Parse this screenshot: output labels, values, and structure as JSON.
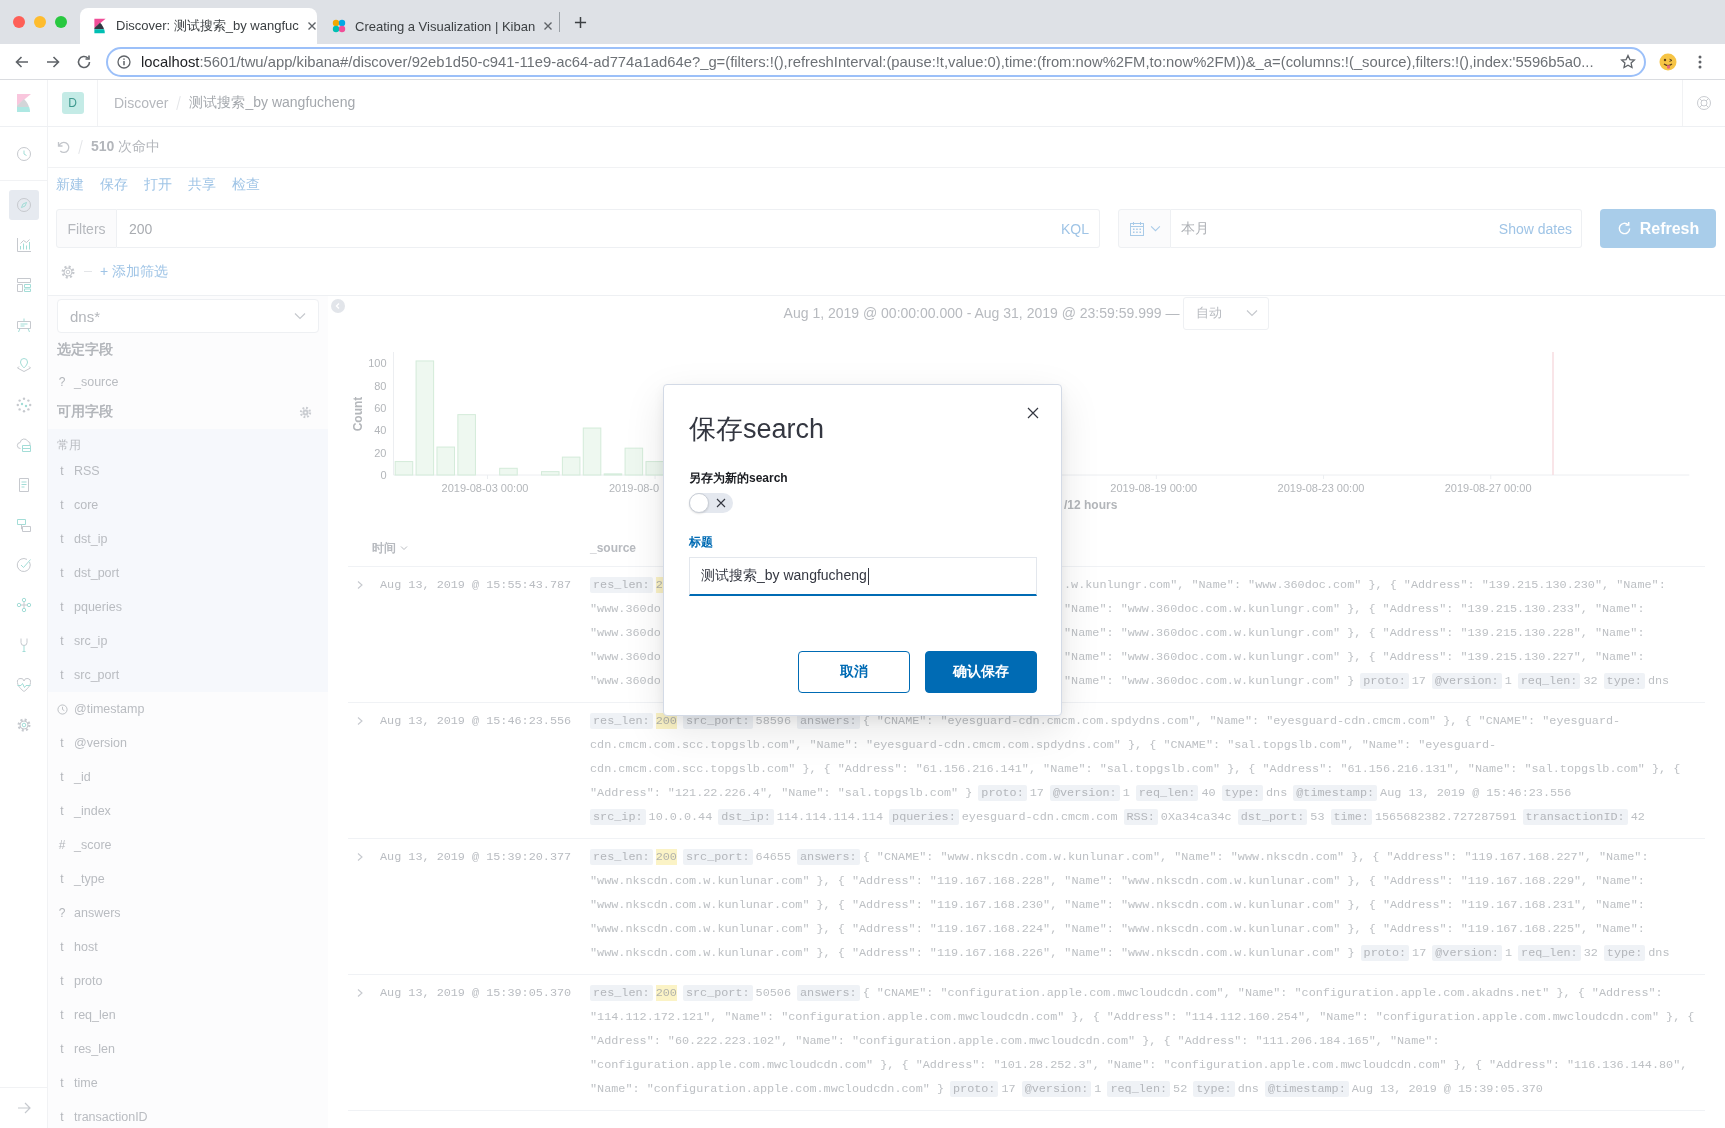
{
  "browser": {
    "tabs": [
      {
        "title": "Discover: 测试搜索_by wangfuc",
        "selected": true
      },
      {
        "title": "Creating a Visualization | Kiban",
        "selected": false
      }
    ],
    "address": {
      "host": "localhost",
      "path": ":5601/twu/app/kibana#/discover/92eb1d50-c941-11e9-ac64-ad774a1ad64e?_g=(filters:!(),refreshInterval:(pause:!t,value:0),time:(from:now%2FM,to:now%2FM))&_a=(columns:!(_source),filters:!(),index:'5596b5a0..."
    }
  },
  "header": {
    "avatar": "D",
    "breadcrumbs": [
      "Discover",
      "测试搜索_by wangfucheng"
    ]
  },
  "nav": {
    "items": [
      {
        "selected": false
      },
      {
        "selected": true
      },
      {
        "selected": false
      },
      {
        "selected": false
      },
      {
        "selected": false
      },
      {
        "selected": false
      },
      {
        "selected": false
      },
      {
        "selected": false
      },
      {
        "selected": false
      },
      {
        "selected": false
      },
      {
        "selected": false
      },
      {
        "selected": false
      },
      {
        "selected": false
      },
      {
        "selected": false
      },
      {
        "selected": false
      }
    ]
  },
  "hits": "**510** 次命中",
  "menu": [
    "新建",
    "保存",
    "打开",
    "共享",
    "检查"
  ],
  "query": {
    "prefix": "Filters",
    "value": "200",
    "language": "KQL"
  },
  "date_picker": {
    "value": "本月",
    "show_dates": "Show dates",
    "refresh": "Refresh"
  },
  "filter_bar": {
    "add": "+ 添加筛选"
  },
  "sidebar": {
    "index_pattern": "dns*",
    "selected": {
      "title": "选定字段",
      "fields": [
        {
          "kind": "typed",
          "type": "?",
          "name": "_source"
        }
      ]
    },
    "available": {
      "title": "可用字段",
      "popular": {
        "title": "常用",
        "fields": [
          {
            "kind": "typed",
            "type": "t",
            "name": "RSS"
          },
          {
            "kind": "typed",
            "type": "t",
            "name": "core"
          },
          {
            "kind": "typed",
            "type": "t",
            "name": "dst_ip"
          },
          {
            "kind": "typed",
            "type": "t",
            "name": "dst_port"
          },
          {
            "kind": "typed",
            "type": "t",
            "name": "pqueries"
          },
          {
            "kind": "typed",
            "type": "t",
            "name": "src_ip"
          },
          {
            "kind": "typed",
            "type": "t",
            "name": "src_port"
          }
        ]
      },
      "fields": [
        {
          "kind": "date",
          "name": "@timestamp"
        },
        {
          "kind": "typed",
          "type": "t",
          "name": "@version"
        },
        {
          "kind": "typed",
          "type": "t",
          "name": "_id"
        },
        {
          "kind": "typed",
          "type": "t",
          "name": "_index"
        },
        {
          "kind": "typed",
          "type": "#",
          "name": "_score"
        },
        {
          "kind": "typed",
          "type": "t",
          "name": "_type"
        },
        {
          "kind": "typed",
          "type": "?",
          "name": "answers"
        },
        {
          "kind": "typed",
          "type": "t",
          "name": "host"
        },
        {
          "kind": "typed",
          "type": "t",
          "name": "proto"
        },
        {
          "kind": "typed",
          "type": "t",
          "name": "req_len"
        },
        {
          "kind": "typed",
          "type": "t",
          "name": "res_len"
        },
        {
          "kind": "typed",
          "type": "t",
          "name": "time"
        },
        {
          "kind": "typed",
          "type": "t",
          "name": "transactionID"
        }
      ]
    }
  },
  "main": {
    "time_range": "Aug 1, 2019 @ 00:00:00.000 - Aug 31, 2019 @ 23:59:59.999 —",
    "interval": "自动",
    "chart_data": {
      "type": "bar",
      "ylabel": "Count",
      "xlabel": "/12 hours",
      "categories": [
        null,
        null,
        null,
        null,
        "2019-08-03 00:00",
        null,
        null,
        null,
        null,
        null,
        null,
        null,
        null,
        null,
        null,
        null,
        null,
        null,
        null,
        null,
        null,
        null,
        null,
        null,
        null,
        null,
        null,
        null,
        null,
        null,
        null,
        null,
        null,
        null,
        null,
        null,
        "2019-08-19 00:00",
        null,
        null,
        null,
        null,
        null,
        null,
        null,
        "2019-08-23 00:00",
        null,
        null,
        null,
        null,
        null,
        null,
        null,
        "2019-08-27 00:00",
        null,
        null,
        null,
        null,
        null,
        null,
        null,
        null,
        null
      ],
      "values": [
        12,
        102,
        25,
        54,
        0,
        6,
        0,
        3,
        16,
        42,
        1,
        24,
        12,
        null,
        null,
        null,
        null,
        null,
        null,
        null,
        null,
        null,
        null,
        null,
        null,
        null,
        null,
        null,
        null,
        null,
        null,
        null,
        0,
        0,
        0,
        0,
        0,
        0,
        0,
        0,
        0,
        0,
        0,
        0,
        0,
        0,
        0,
        0,
        0,
        0,
        0,
        0,
        0,
        0,
        0,
        0,
        0,
        0,
        0,
        0,
        0,
        0
      ],
      "ylim": [
        0,
        110
      ],
      "yticks": [
        0,
        20,
        40,
        60,
        80,
        100
      ],
      "annotations": [
        "2019-08-0"
      ]
    }
  },
  "table": {
    "columns": [
      {
        "label": "时间",
        "sorted": true
      },
      {
        "label": "_source",
        "sorted": false
      }
    ],
    "rows": [
      {
        "time": "Aug 13, 2019 @ 15:55:43.787",
        "expanded": false,
        "lines": [
          {
            "segments": [
              {
                "kind": "key",
                "text": "res_len:"
              },
              {
                "kind": "match",
                "text": "2"
              }
            ],
            "after_cover": [
              {
                "kind": "value",
                "text": ".w.kunlungr.com\", \"Name\": \"www.360doc.com\" }, { \"Address\": \"139.215.130.230\", \"Name\":"
              }
            ]
          },
          {
            "segments": [
              {
                "kind": "value",
                "text": "\"www.360do"
              }
            ],
            "after_cover": [
              {
                "kind": "value",
                "text": "\"Name\": \"www.360doc.com.w.kunlungr.com\" }, { \"Address\": \"139.215.130.233\", \"Name\":"
              }
            ]
          },
          {
            "segments": [
              {
                "kind": "value",
                "text": "\"www.360do"
              }
            ],
            "after_cover": [
              {
                "kind": "value",
                "text": "\"Name\": \"www.360doc.com.w.kunlungr.com\" }, { \"Address\": \"139.215.130.228\", \"Name\":"
              }
            ]
          },
          {
            "segments": [
              {
                "kind": "value",
                "text": "\"www.360do"
              }
            ],
            "after_cover": [
              {
                "kind": "value",
                "text": "\"Name\": \"www.360doc.com.w.kunlungr.com\" }, { \"Address\": \"139.215.130.227\", \"Name\":"
              }
            ]
          },
          {
            "segments": [
              {
                "kind": "value",
                "text": "\"www.360do"
              }
            ],
            "after_cover": [
              {
                "kind": "value",
                "text": "\"Name\": \"www.360doc.com.w.kunlungr.com\" }"
              },
              {
                "kind": "key",
                "text": "proto:"
              },
              {
                "kind": "value",
                "text": "17"
              },
              {
                "kind": "key",
                "text": "@version:"
              },
              {
                "kind": "value",
                "text": "1"
              },
              {
                "kind": "key",
                "text": "req_len:"
              },
              {
                "kind": "value",
                "text": "32"
              },
              {
                "kind": "key",
                "text": "type:"
              },
              {
                "kind": "value",
                "text": "dns"
              }
            ]
          }
        ]
      },
      {
        "time": "Aug 13, 2019 @ 15:46:23.556",
        "expanded": false,
        "lines": [
          {
            "segments": [
              {
                "kind": "key",
                "text": "res_len:"
              },
              {
                "kind": "match",
                "text": "200"
              },
              {
                "kind": "key",
                "text": "src_port:"
              },
              {
                "kind": "value",
                "text": "58596"
              },
              {
                "kind": "key",
                "text": "answers:"
              },
              {
                "kind": "value",
                "text": "{ \"CNAME\": \"eyesguard-cdn.cmcm.com.spdydns.com\", \"Name\": \"eyesguard-cdn.cmcm.com\" }, { \"CNAME\": \"eyesguard-"
              }
            ]
          },
          {
            "segments": [
              {
                "kind": "value",
                "text": "cdn.cmcm.com.scc.topgslb.com\", \"Name\": \"eyesguard-cdn.cmcm.com.spdydns.com\" }, { \"CNAME\": \"sal.topgslb.com\", \"Name\": \"eyesguard-"
              }
            ]
          },
          {
            "segments": [
              {
                "kind": "value",
                "text": "cdn.cmcm.com.scc.topgslb.com\" }, { \"Address\": \"61.156.216.141\", \"Name\": \"sal.topgslb.com\" }, { \"Address\": \"61.156.216.131\", \"Name\": \"sal.topgslb.com\" }, {"
              }
            ]
          },
          {
            "segments": [
              {
                "kind": "value",
                "text": "\"Address\": \"121.22.226.4\", \"Name\": \"sal.topgslb.com\" }"
              },
              {
                "kind": "key",
                "text": "proto:"
              },
              {
                "kind": "value",
                "text": "17"
              },
              {
                "kind": "key",
                "text": "@version:"
              },
              {
                "kind": "value",
                "text": "1"
              },
              {
                "kind": "key",
                "text": "req_len:"
              },
              {
                "kind": "value",
                "text": "40"
              },
              {
                "kind": "key",
                "text": "type:"
              },
              {
                "kind": "value",
                "text": "dns"
              },
              {
                "kind": "key",
                "text": "@timestamp:"
              },
              {
                "kind": "value",
                "text": "Aug 13, 2019 @ 15:46:23.556"
              }
            ]
          },
          {
            "segments": [
              {
                "kind": "key",
                "text": "src_ip:"
              },
              {
                "kind": "value",
                "text": "10.0.0.44"
              },
              {
                "kind": "key",
                "text": "dst_ip:"
              },
              {
                "kind": "value",
                "text": "114.114.114.114"
              },
              {
                "kind": "key",
                "text": "pqueries:"
              },
              {
                "kind": "value",
                "text": "eyesguard-cdn.cmcm.com"
              },
              {
                "kind": "key",
                "text": "RSS:"
              },
              {
                "kind": "value",
                "text": "0Xa34ca34c"
              },
              {
                "kind": "key",
                "text": "dst_port:"
              },
              {
                "kind": "value",
                "text": "53"
              },
              {
                "kind": "key",
                "text": "time:"
              },
              {
                "kind": "value",
                "text": "1565682382.727287591"
              },
              {
                "kind": "key",
                "text": "transactionID:"
              },
              {
                "kind": "value",
                "text": "42"
              }
            ]
          }
        ]
      },
      {
        "time": "Aug 13, 2019 @ 15:39:20.377",
        "expanded": false,
        "lines": [
          {
            "segments": [
              {
                "kind": "key",
                "text": "res_len:"
              },
              {
                "kind": "match",
                "text": "200"
              },
              {
                "kind": "key",
                "text": "src_port:"
              },
              {
                "kind": "value",
                "text": "64655"
              },
              {
                "kind": "key",
                "text": "answers:"
              },
              {
                "kind": "value",
                "text": "{ \"CNAME\": \"www.nkscdn.com.w.kunlunar.com\", \"Name\": \"www.nkscdn.com\" }, { \"Address\": \"119.167.168.227\", \"Name\":"
              }
            ]
          },
          {
            "segments": [
              {
                "kind": "value",
                "text": "\"www.nkscdn.com.w.kunlunar.com\" }, { \"Address\": \"119.167.168.228\", \"Name\": \"www.nkscdn.com.w.kunlunar.com\" }, { \"Address\": \"119.167.168.229\", \"Name\":"
              }
            ]
          },
          {
            "segments": [
              {
                "kind": "value",
                "text": "\"www.nkscdn.com.w.kunlunar.com\" }, { \"Address\": \"119.167.168.230\", \"Name\": \"www.nkscdn.com.w.kunlunar.com\" }, { \"Address\": \"119.167.168.231\", \"Name\":"
              }
            ]
          },
          {
            "segments": [
              {
                "kind": "value",
                "text": "\"www.nkscdn.com.w.kunlunar.com\" }, { \"Address\": \"119.167.168.224\", \"Name\": \"www.nkscdn.com.w.kunlunar.com\" }, { \"Address\": \"119.167.168.225\", \"Name\":"
              }
            ]
          },
          {
            "segments": [
              {
                "kind": "value",
                "text": "\"www.nkscdn.com.w.kunlunar.com\" }, { \"Address\": \"119.167.168.226\", \"Name\": \"www.nkscdn.com.w.kunlunar.com\" }"
              },
              {
                "kind": "key",
                "text": "proto:"
              },
              {
                "kind": "value",
                "text": "17"
              },
              {
                "kind": "key",
                "text": "@version:"
              },
              {
                "kind": "value",
                "text": "1"
              },
              {
                "kind": "key",
                "text": "req_len:"
              },
              {
                "kind": "value",
                "text": "32"
              },
              {
                "kind": "key",
                "text": "type:"
              },
              {
                "kind": "value",
                "text": "dns"
              }
            ]
          }
        ]
      },
      {
        "time": "Aug 13, 2019 @ 15:39:05.370",
        "expanded": false,
        "lines": [
          {
            "segments": [
              {
                "kind": "key",
                "text": "res_len:"
              },
              {
                "kind": "match",
                "text": "200"
              },
              {
                "kind": "key",
                "text": "src_port:"
              },
              {
                "kind": "value",
                "text": "50506"
              },
              {
                "kind": "key",
                "text": "answers:"
              },
              {
                "kind": "value",
                "text": "{ \"CNAME\": \"configuration.apple.com.mwcloudcdn.com\", \"Name\": \"configuration.apple.com.akadns.net\" }, { \"Address\":"
              }
            ]
          },
          {
            "segments": [
              {
                "kind": "value",
                "text": "\"114.112.172.121\", \"Name\": \"configuration.apple.com.mwcloudcdn.com\" }, { \"Address\": \"114.112.160.254\", \"Name\": \"configuration.apple.com.mwcloudcdn.com\" }, {"
              }
            ]
          },
          {
            "segments": [
              {
                "kind": "value",
                "text": "\"Address\": \"60.222.223.102\", \"Name\": \"configuration.apple.com.mwcloudcdn.com\" }, { \"Address\": \"111.206.184.165\", \"Name\":"
              }
            ]
          },
          {
            "segments": [
              {
                "kind": "value",
                "text": "\"configuration.apple.com.mwcloudcdn.com\" }, { \"Address\": \"101.28.252.3\", \"Name\": \"configuration.apple.com.mwcloudcdn.com\" }, { \"Address\": \"116.136.144.80\","
              }
            ]
          },
          {
            "segments": [
              {
                "kind": "value",
                "text": "\"Name\": \"configuration.apple.com.mwcloudcdn.com\" }"
              },
              {
                "kind": "key",
                "text": "proto:"
              },
              {
                "kind": "value",
                "text": "17"
              },
              {
                "kind": "key",
                "text": "@version:"
              },
              {
                "kind": "value",
                "text": "1"
              },
              {
                "kind": "key",
                "text": "req_len:"
              },
              {
                "kind": "value",
                "text": "52"
              },
              {
                "kind": "key",
                "text": "type:"
              },
              {
                "kind": "value",
                "text": "dns"
              },
              {
                "kind": "key",
                "text": "@timestamp:"
              },
              {
                "kind": "value",
                "text": "Aug 13, 2019 @ 15:39:05.370"
              }
            ]
          }
        ]
      }
    ]
  },
  "modal": {
    "title": "保存search",
    "toggle": {
      "label": "另存为新的search",
      "on": false
    },
    "field": {
      "label": "标题",
      "value": "测试搜索_by wangfucheng",
      "focused": true
    },
    "buttons": [
      {
        "label": "取消",
        "kind": "secondary"
      },
      {
        "label": "确认保存",
        "kind": "primary"
      }
    ]
  }
}
